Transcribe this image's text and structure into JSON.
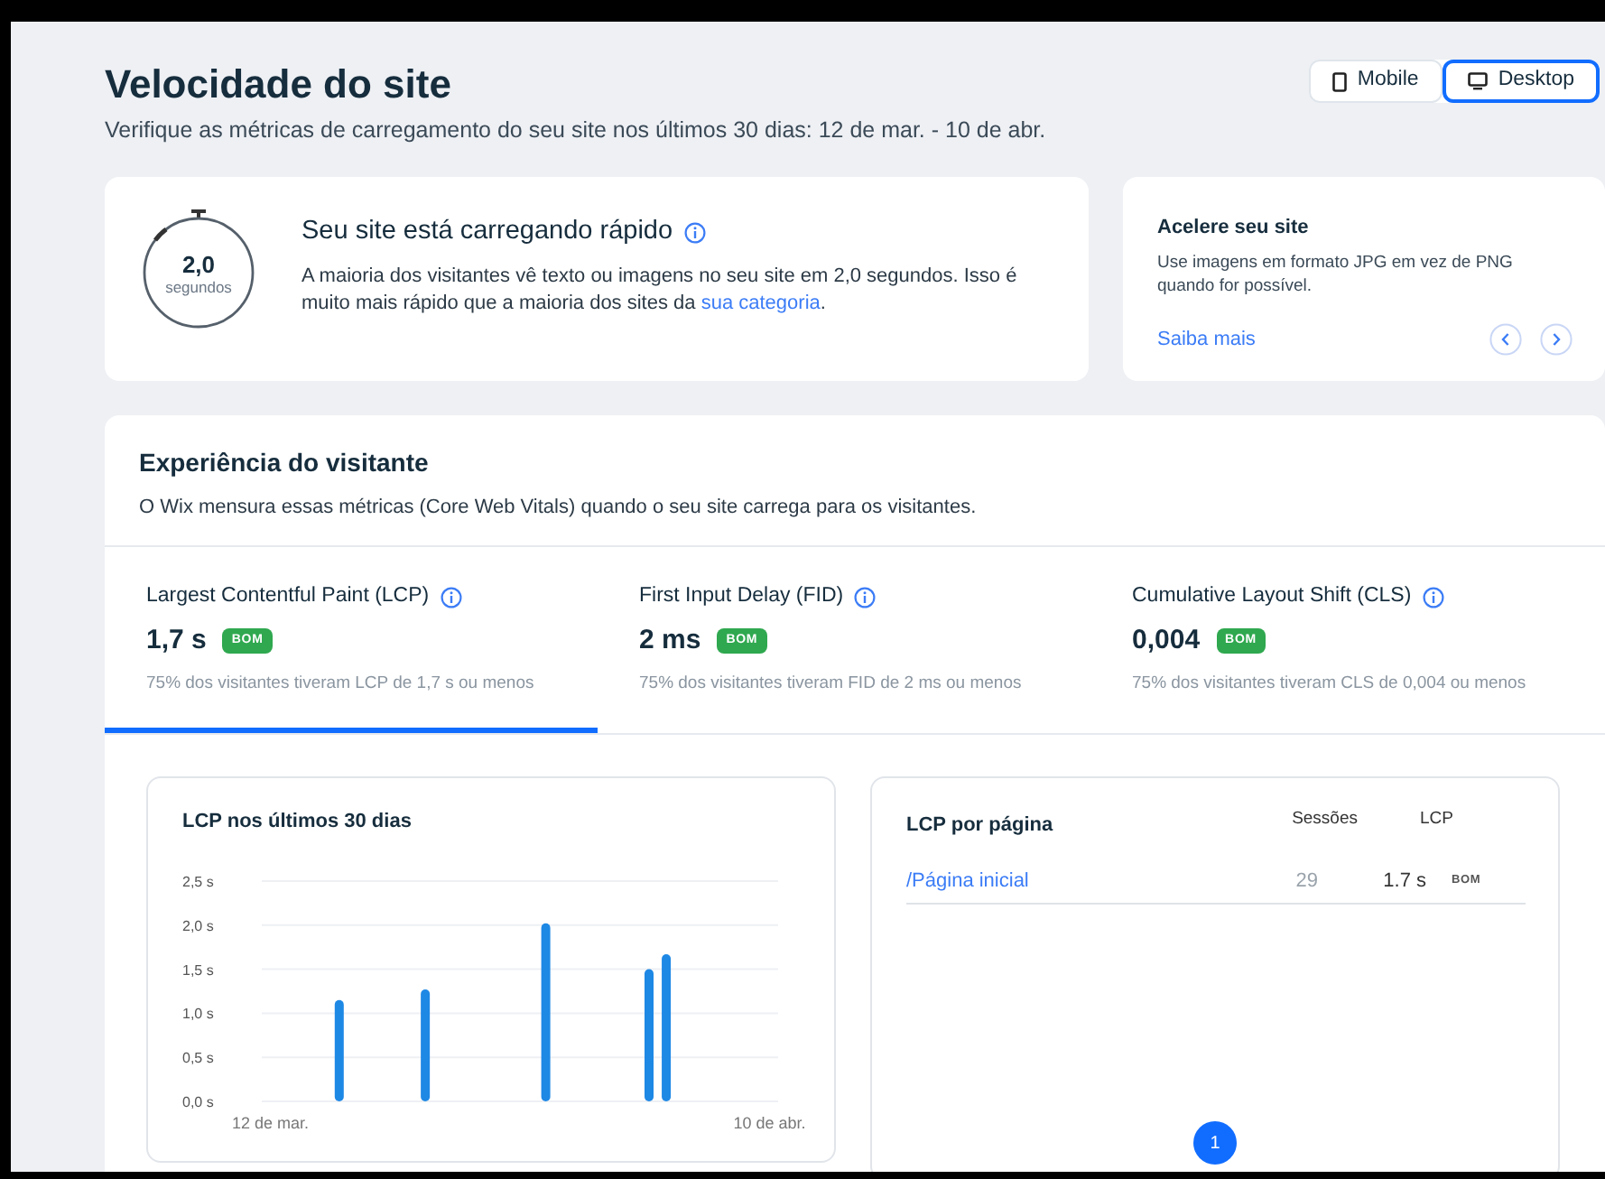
{
  "header": {
    "title": "Velocidade do site",
    "subtitle": "Verifique as métricas de carregamento do seu site nos últimos 30 dias: 12 de mar. - 10 de abr.",
    "devices": [
      {
        "label": "Mobile",
        "kind": "mobile",
        "selected": false
      },
      {
        "label": "Desktop",
        "kind": "desktop",
        "selected": true
      }
    ]
  },
  "summary": {
    "timer_value": "2,0",
    "timer_unit": "segundos",
    "title": "Seu site está carregando rápido",
    "text": "A maioria dos visitantes vê texto ou imagens no seu site em 2,0 segundos. Isso é muito mais rápido que a maioria dos sites da ",
    "link": "sua categoria",
    "text_end": "."
  },
  "tip": {
    "title": "Acelere seu site",
    "text": "Use imagens em formato JPG em vez de PNG quando for possível.",
    "link": "Saiba mais"
  },
  "experience": {
    "title": "Experiência do visitante",
    "subtitle": "O Wix mensura essas métricas (Core Web Vitals) quando o seu site carrega para os visitantes.",
    "metrics": [
      {
        "name": "Largest Contentful Paint (LCP)",
        "value": "1,7 s",
        "badge": "BOM",
        "note": "75% dos visitantes tiveram LCP de 1,7 s ou menos",
        "selected": true
      },
      {
        "name": "First Input Delay (FID)",
        "value": "2 ms",
        "badge": "BOM",
        "note": "75% dos visitantes tiveram FID de 2 ms ou menos",
        "selected": false
      },
      {
        "name": "Cumulative Layout Shift (CLS)",
        "value": "0,004",
        "badge": "BOM",
        "note": "75% dos visitantes tiveram CLS de 0,004 ou menos",
        "selected": false
      }
    ],
    "chart": {
      "chart_data": {
        "type": "bar",
        "title": "LCP nos últimos 30 dias",
        "categories": [
          "12 de mar.",
          null,
          null,
          null,
          null,
          null,
          null,
          null,
          null,
          null,
          null,
          null,
          null,
          null,
          null,
          null,
          null,
          null,
          null,
          null,
          null,
          null,
          null,
          null,
          null,
          null,
          null,
          null,
          null,
          "10 de abr."
        ],
        "series": [
          {
            "color": "#1e88e5",
            "values": [
              null,
              null,
              null,
              null,
              1.15,
              null,
              null,
              null,
              null,
              1.27,
              null,
              null,
              null,
              null,
              null,
              null,
              2.02,
              null,
              null,
              null,
              null,
              null,
              1.5,
              1.67,
              null,
              null,
              null,
              null,
              null,
              null
            ]
          }
        ],
        "ylim": [
          0,
          2.5
        ],
        "grid": true,
        "yticks": [
          {
            "value": 0,
            "label": "0,0 s"
          },
          {
            "value": 0.5,
            "label": "0,5 s"
          },
          {
            "value": 1,
            "label": "1,0 s"
          },
          {
            "value": 1.5,
            "label": "1,5 s"
          },
          {
            "value": 2,
            "label": "2,0 s"
          },
          {
            "value": 2.5,
            "label": "2,5 s"
          }
        ]
      }
    },
    "pages": {
      "title": "LCP por página",
      "columns": [
        "Sessões",
        "LCP"
      ],
      "rows": [
        {
          "page": "/Página inicial",
          "sessions": "29",
          "lcp": "1.7 s",
          "badge": "BOM"
        }
      ],
      "pagination": [
        {
          "label": "1",
          "selected": true
        }
      ]
    }
  }
}
